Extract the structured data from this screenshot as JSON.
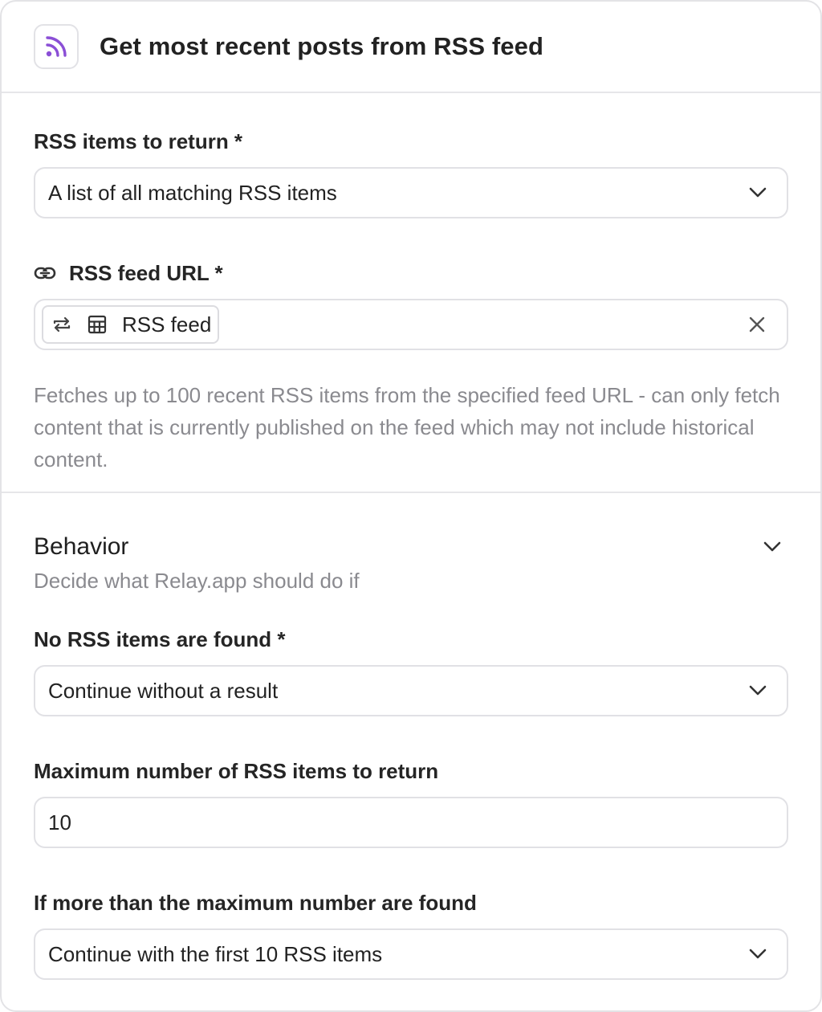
{
  "header": {
    "title": "Get most recent posts from RSS feed",
    "icon": "rss-icon",
    "accent": "#8b4fd6"
  },
  "items_to_return": {
    "label": "RSS items to return *",
    "value": "A list of all matching RSS items"
  },
  "feed_url": {
    "label": "RSS feed URL *",
    "label_icon": "link-icon",
    "token_label": "RSS feed",
    "token_icons": [
      "loop-icon",
      "table-icon"
    ],
    "help": "Fetches up to 100 recent RSS items from the specified feed URL - can only fetch content that is currently published on the feed which may not include historical content."
  },
  "behavior": {
    "title": "Behavior",
    "subtitle": "Decide what Relay.app should do if",
    "no_items": {
      "label": "No RSS items are found *",
      "value": "Continue without a result"
    },
    "max_items": {
      "label": "Maximum number of RSS items to return",
      "value": "10"
    },
    "more_than_max": {
      "label": "If more than the maximum number are found",
      "value": "Continue with the first 10 RSS items"
    }
  }
}
